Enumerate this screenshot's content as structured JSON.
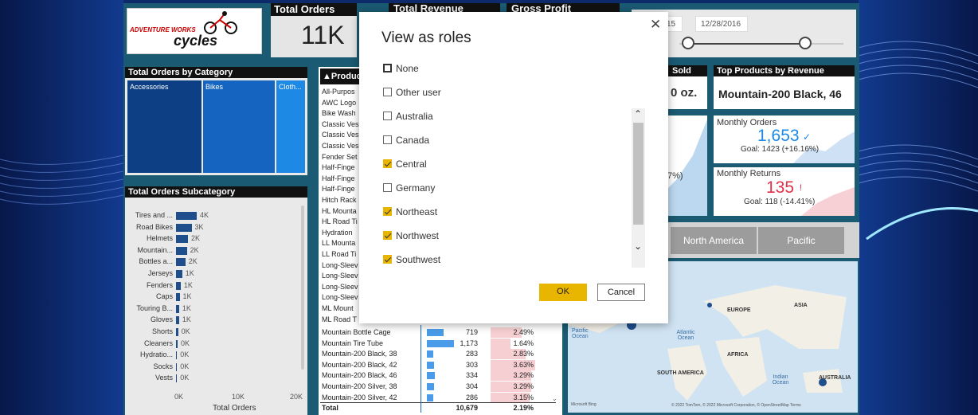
{
  "logo": {
    "line1": "ADVENTURE WORKS",
    "line2": "cycles"
  },
  "kpis": {
    "total_orders": {
      "title": "Total Orders",
      "value": "11K"
    },
    "total_revenue": {
      "title": "Total Revenue"
    },
    "gross_profit": {
      "title": "Gross Profit"
    }
  },
  "date_slicer": {
    "start": "15",
    "end": "12/28/2016"
  },
  "category": {
    "title": "Total Orders by Category",
    "cells": [
      "Accessories",
      "Bikes",
      "Cloth..."
    ]
  },
  "subcategory": {
    "title": "Total Orders Subcategory",
    "xlabel": "Total Orders",
    "xticks": [
      "0K",
      "10K",
      "20K"
    ],
    "rows": [
      {
        "label": "Tires and ...",
        "value": "4K",
        "v": 4
      },
      {
        "label": "Road Bikes",
        "value": "3K",
        "v": 3
      },
      {
        "label": "Helmets",
        "value": "2K",
        "v": 2.3
      },
      {
        "label": "Mountain...",
        "value": "2K",
        "v": 2.1
      },
      {
        "label": "Bottles a...",
        "value": "2K",
        "v": 1.8
      },
      {
        "label": "Jerseys",
        "value": "1K",
        "v": 1.2
      },
      {
        "label": "Fenders",
        "value": "1K",
        "v": 0.9
      },
      {
        "label": "Caps",
        "value": "1K",
        "v": 0.7
      },
      {
        "label": "Touring B...",
        "value": "1K",
        "v": 0.6
      },
      {
        "label": "Gloves",
        "value": "1K",
        "v": 0.6
      },
      {
        "label": "Shorts",
        "value": "0K",
        "v": 0.4
      },
      {
        "label": "Cleaners",
        "value": "0K",
        "v": 0.3
      },
      {
        "label": "Hydratio...",
        "value": "0K",
        "v": 0.2
      },
      {
        "label": "Socks",
        "value": "0K",
        "v": 0.2
      },
      {
        "label": "Vests",
        "value": "0K",
        "v": 0.2
      }
    ]
  },
  "product_table": {
    "header": "ProductN",
    "names": [
      "All-Purpos",
      "AWC Logo",
      "Bike Wash",
      "Classic Ves",
      "Classic Ves",
      "Classic Ves",
      "Fender Set",
      "Half-Finge",
      "Half-Finge",
      "Half-Finge",
      "Hitch Rack",
      "HL Mounta",
      "HL Road Ti",
      "Hydration",
      "LL Mounta",
      "LL Road Ti",
      "Long-Sleev",
      "Long-Sleev",
      "Long-Sleev",
      "Long-Sleev",
      "ML Mount",
      "ML Road T"
    ],
    "rows": [
      {
        "name": "Mountain Bottle Cage",
        "qty": "719",
        "pct": "2.49%",
        "q": 0.31,
        "p": 0.69
      },
      {
        "name": "Mountain Tire Tube",
        "qty": "1,173",
        "pct": "1.64%",
        "q": 0.5,
        "p": 0.45
      },
      {
        "name": "Mountain-200 Black, 38",
        "qty": "283",
        "pct": "2.83%",
        "q": 0.12,
        "p": 0.78
      },
      {
        "name": "Mountain-200 Black, 42",
        "qty": "303",
        "pct": "3.63%",
        "q": 0.13,
        "p": 1.0
      },
      {
        "name": "Mountain-200 Black, 46",
        "qty": "334",
        "pct": "3.29%",
        "q": 0.14,
        "p": 0.91
      },
      {
        "name": "Mountain-200 Silver, 38",
        "qty": "304",
        "pct": "3.29%",
        "q": 0.13,
        "p": 0.91
      },
      {
        "name": "Mountain-200 Silver, 42",
        "qty": "286",
        "pct": "3.15%",
        "q": 0.12,
        "p": 0.87
      }
    ],
    "total": {
      "label": "Total",
      "qty": "10,679",
      "pct": "2.19%"
    }
  },
  "right": {
    "sold_title": "Sold",
    "sold_value": "0 oz.",
    "top_products": {
      "title": "Top Products by Revenue",
      "value": "Mountain-200 Black, 46"
    },
    "monthly_orders": {
      "title": "Monthly Orders",
      "value": "1,653",
      "goal": "Goal: 1423 (+16.16%)"
    },
    "monthly_returns": {
      "title": "Monthly Returns",
      "value": "135",
      "goal": "Goal: 118 (-14.41%)"
    },
    "partial_pct": "7%)",
    "regions": [
      "North America",
      "Pacific"
    ]
  },
  "map": {
    "labels": [
      "EUROPE",
      "ASIA",
      "Pacific Ocean",
      "Atlantic Ocean",
      "AFRICA",
      "SOUTH AMERICA",
      "Indian Ocean",
      "AUSTRALIA"
    ],
    "brand": "Microsoft Bing",
    "credit": "© 2022 TomTom, © 2022 Microsoft Corporation, © OpenStreetMap  Terms"
  },
  "dialog": {
    "title": "View as roles",
    "roles": [
      {
        "label": "None",
        "checked": false
      },
      {
        "label": "Other user",
        "checked": false
      },
      {
        "label": "Australia",
        "checked": false
      },
      {
        "label": "Canada",
        "checked": false
      },
      {
        "label": "Central",
        "checked": true
      },
      {
        "label": "Germany",
        "checked": false
      },
      {
        "label": "Northeast",
        "checked": true
      },
      {
        "label": "Northwest",
        "checked": true
      },
      {
        "label": "Southwest",
        "checked": true
      }
    ],
    "ok": "OK",
    "cancel": "Cancel"
  },
  "colors": {
    "accent": "#e8b500",
    "bar": "#1f4e8c",
    "tile_blue": "#1565c0"
  }
}
